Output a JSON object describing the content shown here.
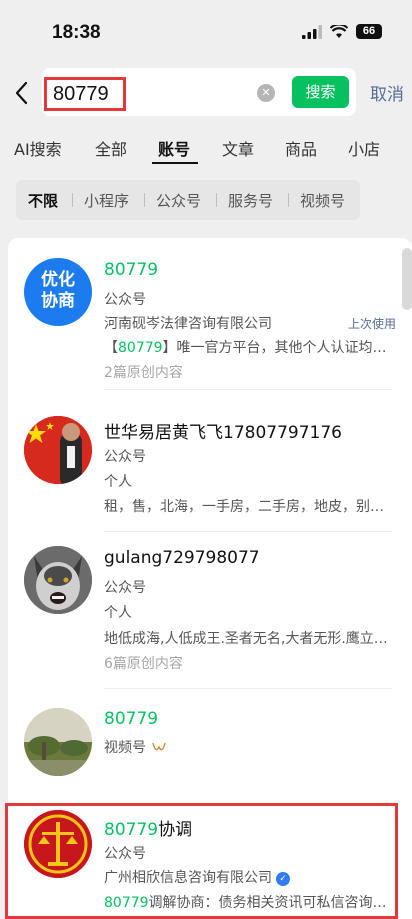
{
  "status_bar": {
    "time": "18:38",
    "battery": "66"
  },
  "search": {
    "query": "80779",
    "button": "搜索",
    "cancel": "取消"
  },
  "tabs": [
    "AI搜索",
    "全部",
    "账号",
    "文章",
    "商品",
    "小店"
  ],
  "filters": [
    "不限",
    "小程序",
    "公众号",
    "服务号",
    "视频号"
  ],
  "results": [
    {
      "title_hl": "80779",
      "title_rest": "",
      "type": "公众号",
      "owner": "河南砚岑法律咨询有限公司",
      "badge": "上次使用",
      "desc_hl": "80779",
      "desc_prefix": "【",
      "desc_rest": "】唯一官方平台，其他个人认证均…",
      "meta": "2篇原创内容",
      "avatar_text": [
        "优化",
        "协商"
      ]
    },
    {
      "title": "世华易居黄飞飞17807797176",
      "type": "公众号",
      "owner": "个人",
      "desc": "租，售，北海，一手房，二手房，地皮，别…"
    },
    {
      "title": "gulang729798077",
      "type": "公众号",
      "owner": "个人",
      "desc": "地低成海,人低成王.圣者无名,大者无形.鹰立…",
      "meta": "6篇原创内容"
    },
    {
      "title_hl": "80779",
      "type": "视频号"
    },
    {
      "title_hl": "80779",
      "title_rest": "协调",
      "type": "公众号",
      "owner": "广州相欣信息咨询有限公司",
      "desc_hl": "80779",
      "desc_rest": "调解协商：债务相关资讯可私信咨询…"
    }
  ]
}
